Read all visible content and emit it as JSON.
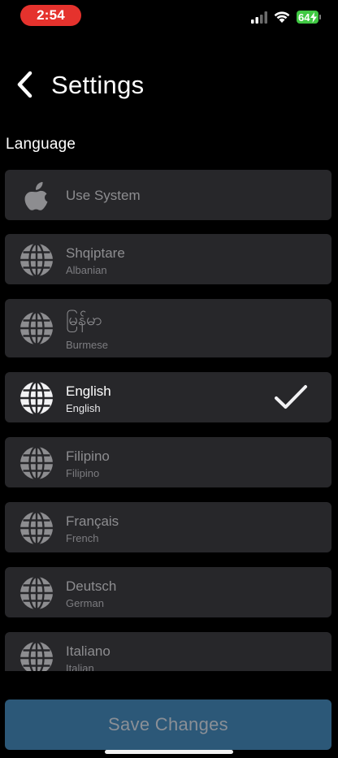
{
  "status_bar": {
    "time": "2:54",
    "battery": "64",
    "colors": {
      "time_pill": "#e5322d",
      "battery": "#40c843"
    },
    "icons": [
      "signal-icon",
      "wifi-icon",
      "battery-icon"
    ]
  },
  "header": {
    "back_icon": "chevron-left-icon",
    "title": "Settings"
  },
  "section": {
    "title": "Language"
  },
  "languages": [
    {
      "name": "Use System",
      "sub": "",
      "icon": "apple-icon",
      "selected": false
    },
    {
      "name": "Shqiptare",
      "sub": "Albanian",
      "icon": "globe-icon",
      "selected": false
    },
    {
      "name": "မြန်မာ",
      "sub": "Burmese",
      "icon": "globe-icon",
      "selected": false
    },
    {
      "name": "English",
      "sub": "English",
      "icon": "globe-icon",
      "selected": true
    },
    {
      "name": "Filipino",
      "sub": "Filipino",
      "icon": "globe-icon",
      "selected": false
    },
    {
      "name": "Français",
      "sub": "French",
      "icon": "globe-icon",
      "selected": false
    },
    {
      "name": "Deutsch",
      "sub": "German",
      "icon": "globe-icon",
      "selected": false
    },
    {
      "name": "Italiano",
      "sub": "Italian",
      "icon": "globe-icon",
      "selected": false
    }
  ],
  "selected_icon": "checkmark-icon",
  "footer": {
    "save_label": "Save Changes",
    "colors": {
      "save_button": "#2c5878"
    }
  }
}
